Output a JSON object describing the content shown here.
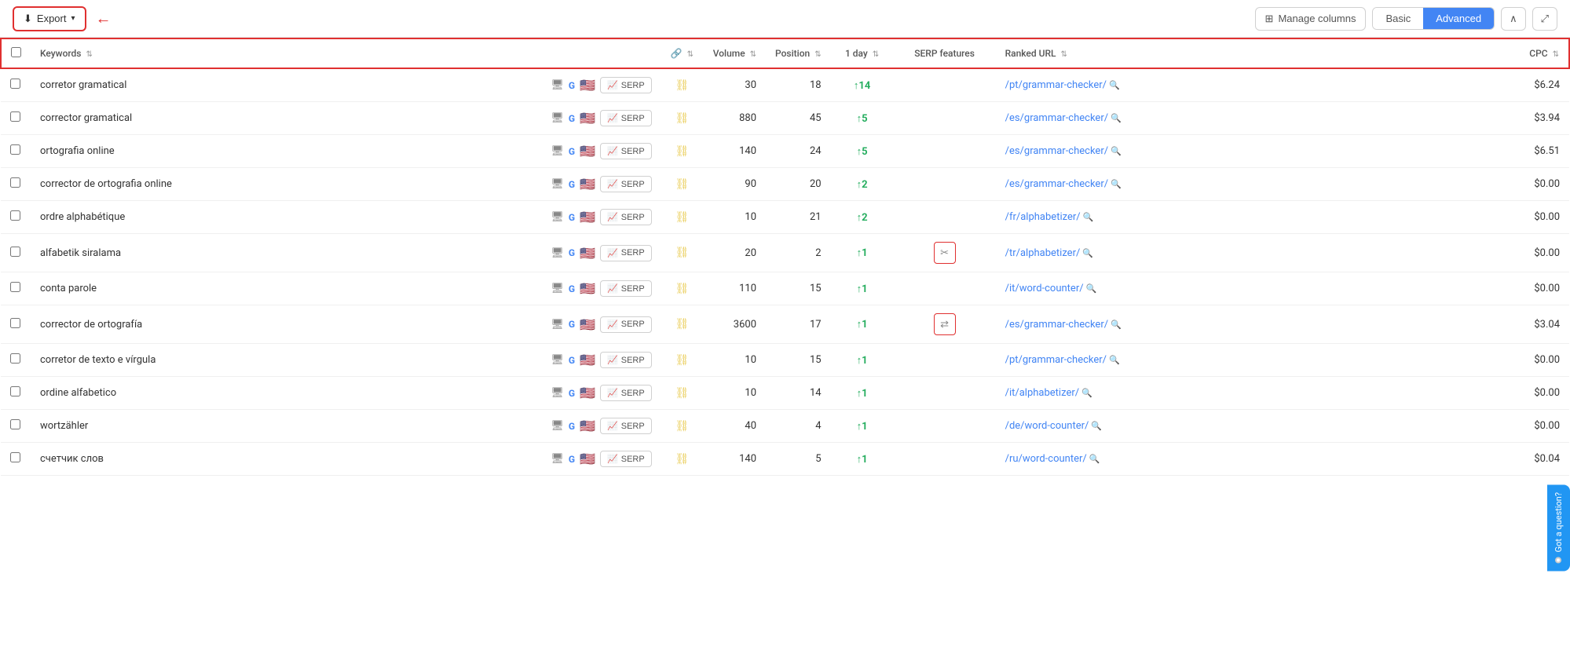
{
  "toolbar": {
    "export_label": "Export",
    "manage_columns_label": "Manage columns",
    "basic_label": "Basic",
    "advanced_label": "Advanced",
    "collapse_icon": "∧",
    "expand_icon": "⤢"
  },
  "table": {
    "headers": [
      {
        "id": "checkbox",
        "label": ""
      },
      {
        "id": "keyword",
        "label": "Keywords",
        "sortable": true
      },
      {
        "id": "icons",
        "label": ""
      },
      {
        "id": "link",
        "label": "🔗",
        "sortable": false
      },
      {
        "id": "volume",
        "label": "Volume",
        "sortable": true
      },
      {
        "id": "position",
        "label": "Position",
        "sortable": true
      },
      {
        "id": "day1",
        "label": "1 day",
        "sortable": true
      },
      {
        "id": "serp",
        "label": "SERP features"
      },
      {
        "id": "url",
        "label": "Ranked URL",
        "sortable": true
      },
      {
        "id": "cpc",
        "label": "CPC",
        "sortable": true
      }
    ],
    "rows": [
      {
        "keyword": "corretor gramatical",
        "volume": "30",
        "position": "18",
        "day_change": "+14",
        "day_direction": "up",
        "serp_feature": "",
        "ranked_url": "/pt/grammar-checker/",
        "cpc": "$6.24"
      },
      {
        "keyword": "corrector gramatical",
        "volume": "880",
        "position": "45",
        "day_change": "+5",
        "day_direction": "up",
        "serp_feature": "",
        "ranked_url": "/es/grammar-checker/",
        "cpc": "$3.94"
      },
      {
        "keyword": "ortografia online",
        "volume": "140",
        "position": "24",
        "day_change": "+5",
        "day_direction": "up",
        "serp_feature": "",
        "ranked_url": "/es/grammar-checker/",
        "cpc": "$6.51"
      },
      {
        "keyword": "corrector de ortografia online",
        "volume": "90",
        "position": "20",
        "day_change": "+2",
        "day_direction": "up",
        "serp_feature": "",
        "ranked_url": "/es/grammar-checker/",
        "cpc": "$0.00"
      },
      {
        "keyword": "ordre alphabétique",
        "volume": "10",
        "position": "21",
        "day_change": "+2",
        "day_direction": "up",
        "serp_feature": "",
        "ranked_url": "/fr/alphabetizer/",
        "cpc": "$0.00"
      },
      {
        "keyword": "alfabetik siralama",
        "volume": "20",
        "position": "2",
        "day_change": "+1",
        "day_direction": "up",
        "serp_feature": "scissors",
        "ranked_url": "/tr/alphabetizer/",
        "cpc": "$0.00"
      },
      {
        "keyword": "conta parole",
        "volume": "110",
        "position": "15",
        "day_change": "+1",
        "day_direction": "up",
        "serp_feature": "",
        "ranked_url": "/it/word-counter/",
        "cpc": "$0.00"
      },
      {
        "keyword": "corrector de ortografía",
        "volume": "3600",
        "position": "17",
        "day_change": "+1",
        "day_direction": "up",
        "serp_feature": "swap",
        "ranked_url": "/es/grammar-checker/",
        "cpc": "$3.04"
      },
      {
        "keyword": "corretor de texto e vírgula",
        "volume": "10",
        "position": "15",
        "day_change": "+1",
        "day_direction": "up",
        "serp_feature": "",
        "ranked_url": "/pt/grammar-checker/",
        "cpc": "$0.00"
      },
      {
        "keyword": "ordine alfabetico",
        "volume": "10",
        "position": "14",
        "day_change": "+1",
        "day_direction": "up",
        "serp_feature": "",
        "ranked_url": "/it/alphabetizer/",
        "cpc": "$0.00"
      },
      {
        "keyword": "wortzähler",
        "volume": "40",
        "position": "4",
        "day_change": "+1",
        "day_direction": "up",
        "serp_feature": "",
        "ranked_url": "/de/word-counter/",
        "cpc": "$0.00"
      },
      {
        "keyword": "счетчик слов",
        "volume": "140",
        "position": "5",
        "day_change": "+1",
        "day_direction": "up",
        "serp_feature": "",
        "ranked_url": "/ru/word-counter/",
        "cpc": "$0.04"
      }
    ]
  },
  "chat_widget": {
    "label": "Got a question?"
  }
}
